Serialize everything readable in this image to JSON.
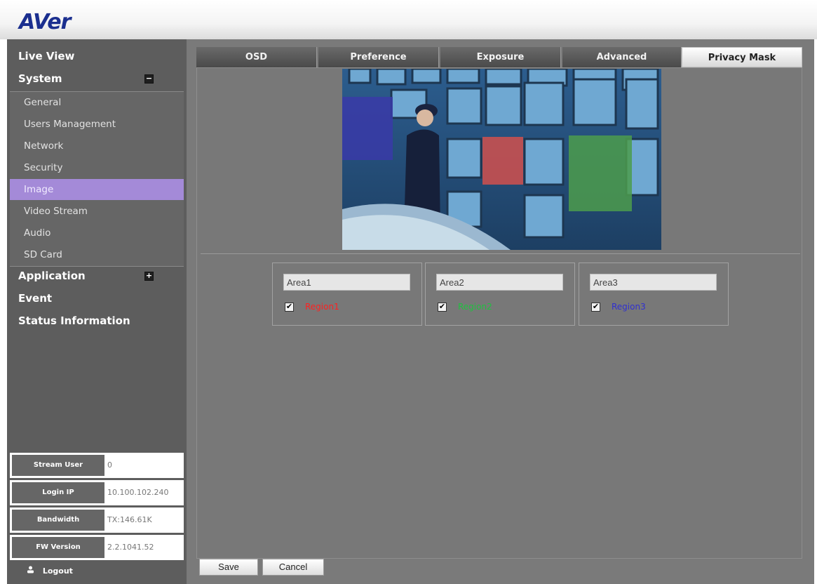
{
  "brand": {
    "logo": "AVer"
  },
  "sidebar": {
    "live_view": "Live View",
    "system": "System",
    "system_toggle": "−",
    "system_items": [
      "General",
      "Users Management",
      "Network",
      "Security",
      "Image",
      "Video Stream",
      "Audio",
      "SD Card"
    ],
    "active_item": "Image",
    "application": "Application",
    "application_toggle": "+",
    "event": "Event",
    "status_information": "Status Information"
  },
  "info": {
    "stream_user_label": "Stream User",
    "stream_user_value": "0",
    "login_ip_label": "Login IP",
    "login_ip_value": "10.100.102.240",
    "bandwidth_label": "Bandwidth",
    "bandwidth_value": "TX:146.61K",
    "fw_version_label": "FW Version",
    "fw_version_value": "2.2.1041.52",
    "logout_label": "Logout"
  },
  "tabs": [
    "OSD",
    "Preference",
    "Exposure",
    "Advanced",
    "Privacy Mask"
  ],
  "active_tab": "Privacy Mask",
  "areas": [
    {
      "name": "Area1",
      "region": "Region1",
      "checked": true,
      "color": "#ff2020"
    },
    {
      "name": "Area2",
      "region": "Region2",
      "checked": true,
      "color": "#20c040"
    },
    {
      "name": "Area3",
      "region": "Region3",
      "checked": true,
      "color": "#3030d0"
    }
  ],
  "buttons": {
    "save": "Save",
    "cancel": "Cancel"
  }
}
